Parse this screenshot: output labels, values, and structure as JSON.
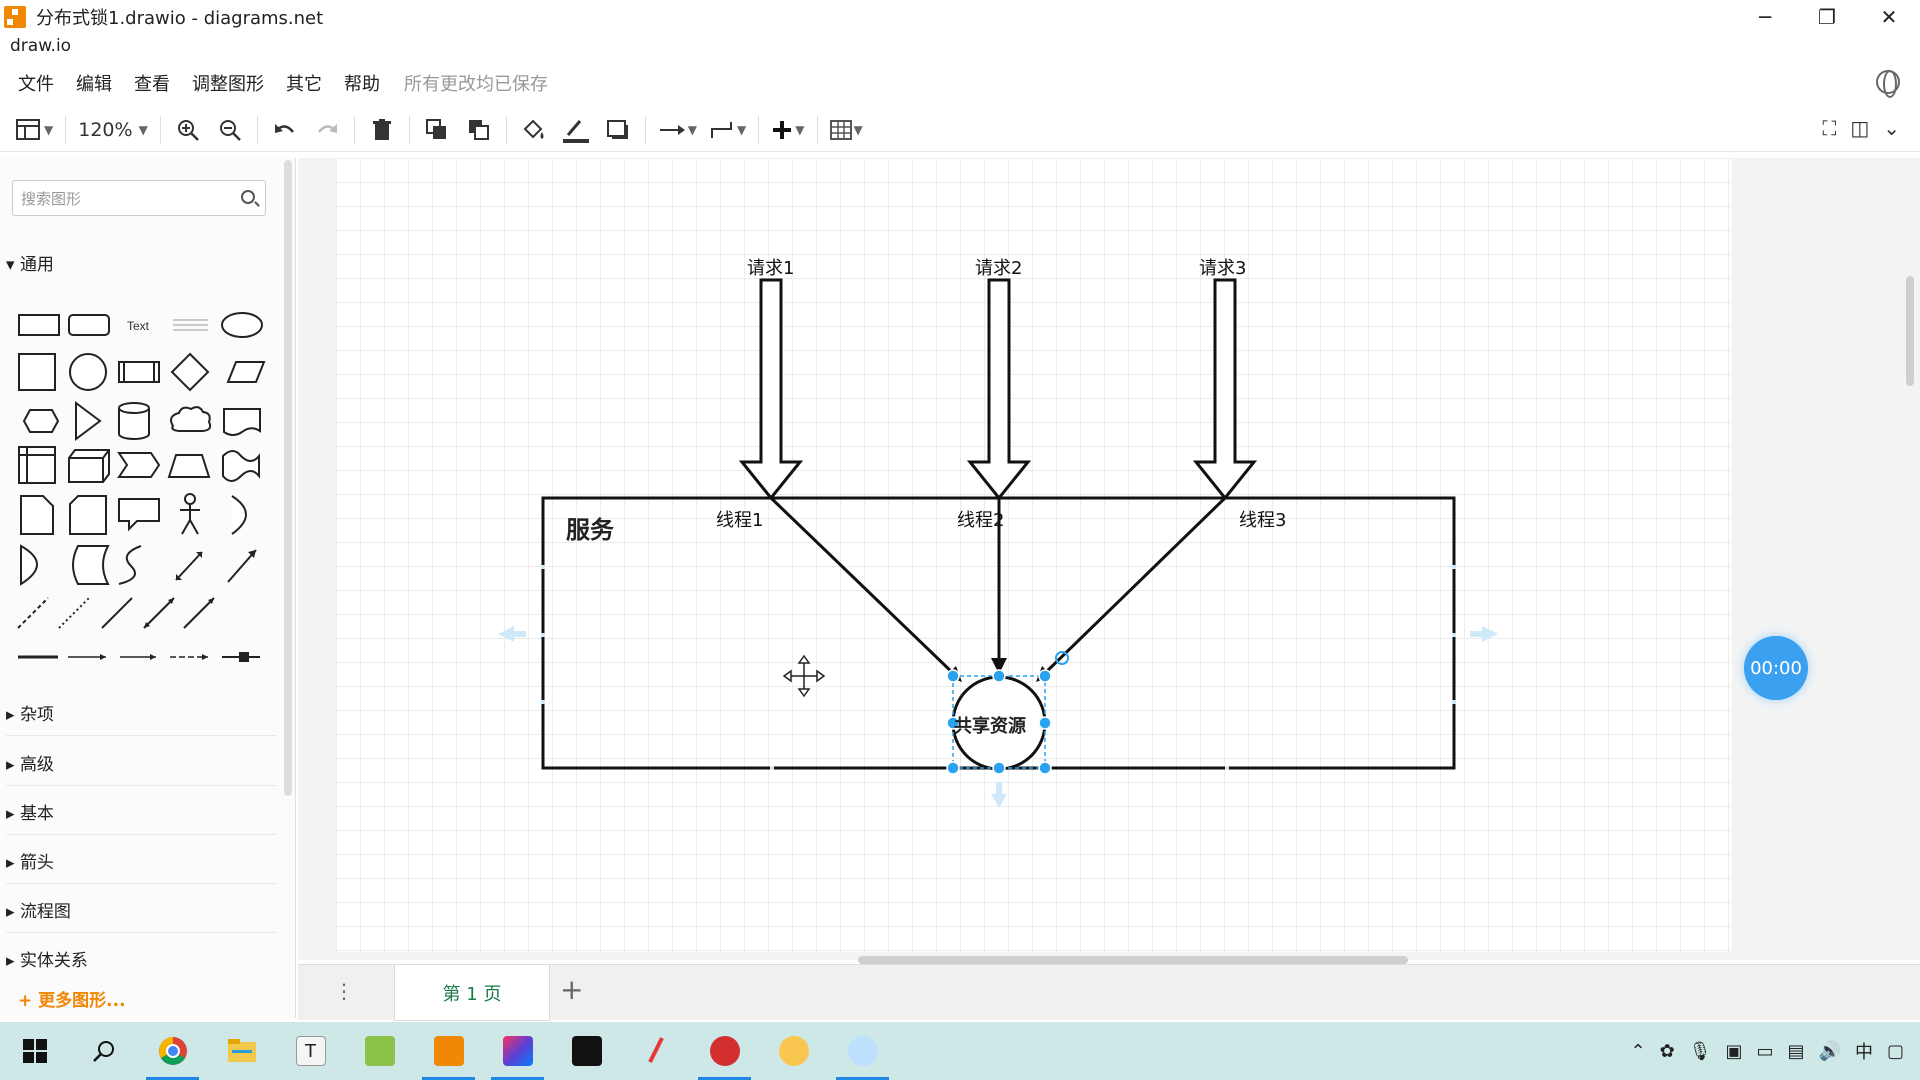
{
  "window": {
    "title": "分布式锁1.drawio - diagrams.net",
    "subtitle": "draw.io",
    "controls": [
      "─",
      "❐",
      "✕"
    ]
  },
  "menu": {
    "items": [
      "文件",
      "编辑",
      "查看",
      "调整图形",
      "其它",
      "帮助"
    ],
    "status": "所有更改均已保存"
  },
  "toolbar": {
    "zoom": "120%"
  },
  "sidebar": {
    "search_placeholder": "搜索图形",
    "general_label": "通用",
    "text_shape_label": "Text",
    "sections": [
      "杂项",
      "高级",
      "基本",
      "箭头",
      "流程图",
      "实体关系"
    ],
    "more_shapes": "更多图形..."
  },
  "diagram": {
    "requests": [
      "请求1",
      "请求2",
      "请求3"
    ],
    "threads": [
      "线程1",
      "线程2",
      "线程3"
    ],
    "service_title": "服务",
    "shared_resource": "共享资源"
  },
  "timer": "00:00",
  "pages": {
    "tabs": [
      "第 1 页"
    ],
    "add": "+"
  },
  "colors": {
    "accent": "#f08705",
    "selection": "#29a3ef",
    "taskbar": "#cde8e6"
  }
}
